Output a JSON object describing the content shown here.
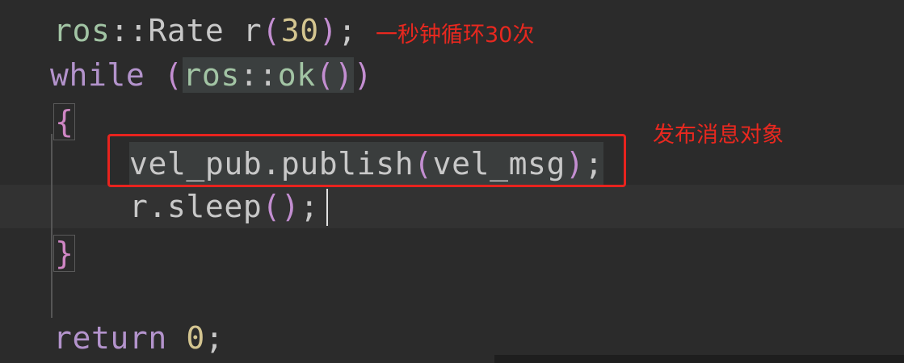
{
  "code": {
    "line1": {
      "ns": "ros",
      "sep": "::",
      "type": "Rate",
      "var": " r",
      "open": "(",
      "num": "30",
      "close": ")",
      "semi": ";"
    },
    "line2": {
      "kw": "while",
      "space": " ",
      "open": "(",
      "ns": "ros",
      "sep": "::",
      "fn": "ok",
      "fn_parens": "()",
      "close": ")"
    },
    "line3": {
      "brace": "{"
    },
    "line4": {
      "text": "vel_pub.publish",
      "open": "(",
      "arg": "vel_msg",
      "close": ")",
      "semi": ";"
    },
    "line5": {
      "text": "r.sleep",
      "parens": "()",
      "semi": ";"
    },
    "line6": {
      "brace": "}"
    },
    "line7": {
      "kw": "return",
      "space": " ",
      "num": "0",
      "semi": ";"
    }
  },
  "annotations": {
    "loop_rate": "一秒钟循环30次",
    "publish": "发布消息对象"
  },
  "colors": {
    "background": "#2b2b2b",
    "annotation": "#e8281f",
    "highlight_box": "#e8231e"
  }
}
